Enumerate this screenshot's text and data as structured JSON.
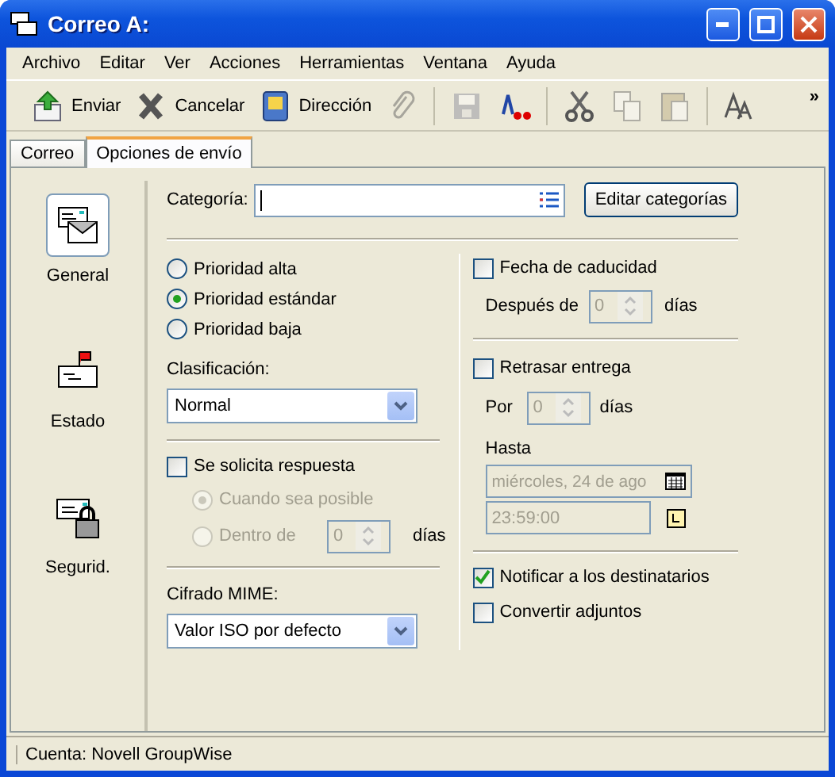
{
  "window": {
    "title": "Correo A:"
  },
  "menu": [
    "Archivo",
    "Editar",
    "Ver",
    "Acciones",
    "Herramientas",
    "Ventana",
    "Ayuda"
  ],
  "toolbar": [
    {
      "kind": "send",
      "label": "Enviar",
      "disabled": false
    },
    {
      "kind": "cancel",
      "label": "Cancelar",
      "disabled": false
    },
    {
      "kind": "address",
      "label": "Dirección",
      "disabled": false
    },
    {
      "kind": "attach",
      "disabled": true
    },
    {
      "kind": "sep"
    },
    {
      "kind": "save",
      "disabled": true
    },
    {
      "kind": "spell",
      "disabled": false
    },
    {
      "kind": "sep"
    },
    {
      "kind": "cut",
      "disabled": false
    },
    {
      "kind": "copy",
      "disabled": true
    },
    {
      "kind": "paste",
      "disabled": true
    },
    {
      "kind": "sep"
    },
    {
      "kind": "font",
      "disabled": false
    }
  ],
  "toolbar_more": "»",
  "tabs": [
    {
      "label": "Correo",
      "selected": false
    },
    {
      "label": "Opciones de envío",
      "selected": true
    }
  ],
  "nav": [
    {
      "kind": "general",
      "label": "General",
      "selected": true
    },
    {
      "kind": "status",
      "label": "Estado",
      "selected": false
    },
    {
      "kind": "security",
      "label": "Segurid.",
      "selected": false
    }
  ],
  "category": {
    "label": "Categoría:",
    "button": "Editar categorías"
  },
  "priority": [
    {
      "label": "Prioridad alta",
      "selected": false
    },
    {
      "label": "Prioridad estándar",
      "selected": true
    },
    {
      "label": "Prioridad baja",
      "selected": false
    }
  ],
  "classification": {
    "label": "Clasificación:",
    "value": "Normal"
  },
  "reply": {
    "label": "Se solicita respuesta",
    "checked": false,
    "options": [
      {
        "label": "Cuando sea posible",
        "selected": true,
        "disabled": true
      },
      {
        "label": "Dentro de",
        "selected": false,
        "disabled": true,
        "value": "0",
        "unit": "días"
      }
    ]
  },
  "mime": {
    "label": "Cifrado MIME:",
    "value": "Valor ISO por defecto"
  },
  "expiration": {
    "label": "Fecha de caducidad",
    "checked": false,
    "after_label": "Después de",
    "value": "0",
    "unit": "días",
    "disabled": true
  },
  "delay": {
    "label": "Retrasar entrega",
    "checked": false,
    "by_label": "Por",
    "value": "0",
    "unit": "días",
    "until_label": "Hasta",
    "date": "miércoles, 24 de ago",
    "time": "23:59:00",
    "disabled": true
  },
  "notify": {
    "label": "Notificar a los destinatarios",
    "checked": true
  },
  "convert": {
    "label": "Convertir adjuntos",
    "checked": false
  },
  "status_bar": "Cuenta: Novell GroupWise"
}
